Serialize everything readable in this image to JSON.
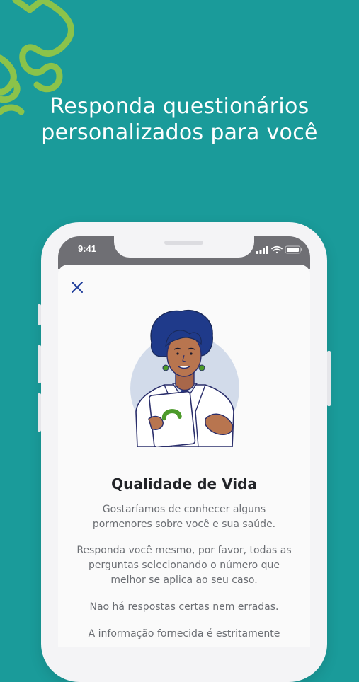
{
  "headline": {
    "line1": "Responda questionários",
    "line2": "personalizados para você"
  },
  "status_bar": {
    "time": "9:41",
    "icons": [
      "signal-icon",
      "wifi-icon",
      "battery-icon"
    ]
  },
  "modal": {
    "close_icon": "close-icon",
    "title": "Qualidade de Vida",
    "paragraphs": [
      [
        "Gostaríamos de conhecer alguns",
        "pormenores sobre você e sua saúde."
      ],
      [
        "Responda você mesmo, por favor, todas as",
        "perguntas selecionando o número que",
        "melhor se aplica ao seu caso."
      ],
      [
        "Nao há respostas certas nem erradas."
      ],
      [
        "A informação fornecida é estritamente"
      ]
    ]
  },
  "colors": {
    "background": "#1a9b9a",
    "logo_green": "#8bc34a",
    "accent_blue": "#1f3e9b",
    "text_dark": "#222428",
    "text_muted": "#6b6e73"
  }
}
